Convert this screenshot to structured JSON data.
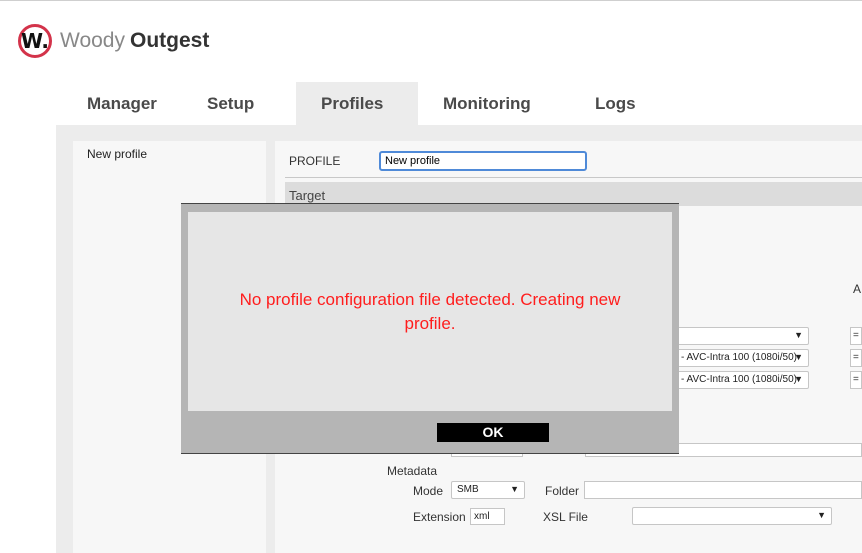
{
  "app": {
    "brand_light": "Woody",
    "brand_bold": "Outgest",
    "logo_letter": "W."
  },
  "tabs": [
    {
      "label": "Manager",
      "active": false
    },
    {
      "label": "Setup",
      "active": false
    },
    {
      "label": "Profiles",
      "active": true
    },
    {
      "label": "Monitoring",
      "active": false
    },
    {
      "label": "Logs",
      "active": false
    }
  ],
  "sidebar": {
    "items": [
      {
        "label": "New profile"
      }
    ]
  },
  "profile": {
    "label": "PROFILE",
    "name_value": "New profile",
    "section_title": "Target",
    "a_label": "A",
    "selects": [
      {
        "value": "",
        "arrow": "▼"
      },
      {
        "value": "- AVC-Intra 100 (1080i/50)",
        "arrow": "▼"
      },
      {
        "value": "- AVC-Intra 100 (1080i/50)",
        "arrow": "▼"
      }
    ],
    "eq_symbol": "="
  },
  "metadata": {
    "title": "Metadata",
    "mode_label": "Mode",
    "mode_value": "SMB",
    "folder_label": "Folder",
    "folder_value": "",
    "extension_label": "Extension",
    "extension_value": "xml",
    "xsl_label": "XSL File",
    "xsl_value": ""
  },
  "modal": {
    "message": "No profile configuration file detected. Creating new profile.",
    "ok_label": "OK"
  },
  "colors": {
    "accent": "#d3334a",
    "error": "#ff1d1d",
    "focus": "#4f8ad8",
    "tab_active_bg": "#ececec"
  }
}
